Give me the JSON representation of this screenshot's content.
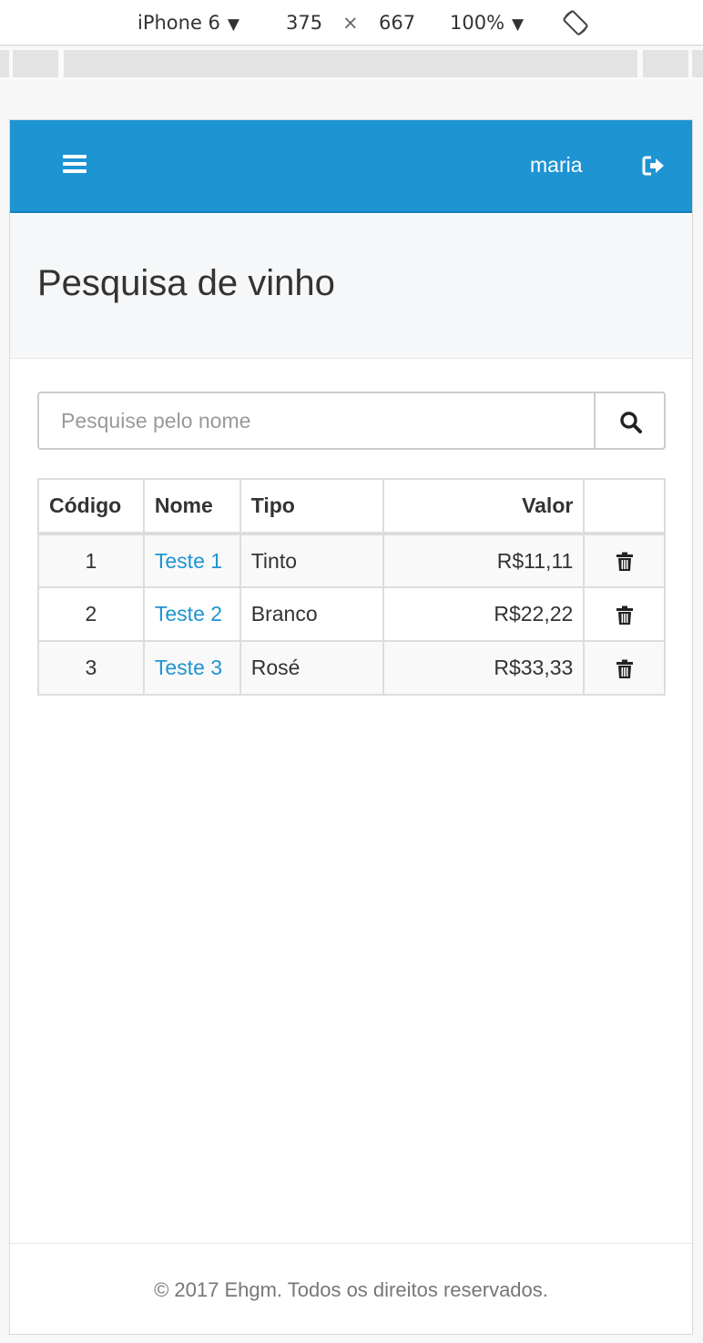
{
  "devtools": {
    "device": "iPhone 6",
    "width": "375",
    "times": "×",
    "height": "667",
    "zoom": "100%",
    "caret": "▼"
  },
  "navbar": {
    "username": "maria",
    "menu_icon": "bars-icon",
    "logout_icon": "sign-out-icon",
    "color": "#1e94d2"
  },
  "page": {
    "title": "Pesquisa de vinho"
  },
  "search": {
    "placeholder": "Pesquise pelo nome",
    "value": "",
    "icon": "search-icon"
  },
  "table": {
    "columns": [
      "Código",
      "Nome",
      "Tipo",
      "Valor",
      ""
    ],
    "rows": [
      {
        "code": "1",
        "name": "Teste 1",
        "type": "Tinto",
        "value": "R$11,11"
      },
      {
        "code": "2",
        "name": "Teste 2",
        "type": "Branco",
        "value": "R$22,22"
      },
      {
        "code": "3",
        "name": "Teste 3",
        "type": "Rosé",
        "value": "R$33,33"
      }
    ],
    "action_icon": "trash-icon",
    "link_color": "#1e94d2"
  },
  "footer": {
    "text": "© 2017 Ehgm. Todos os direitos reservados."
  }
}
